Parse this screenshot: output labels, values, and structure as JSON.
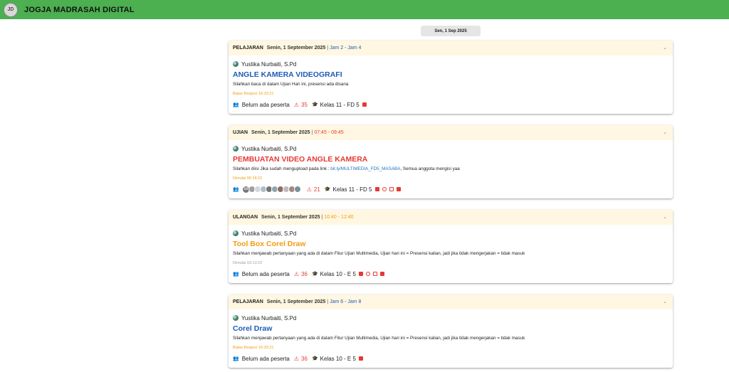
{
  "app": {
    "title": "JOGJA MADRASAH DIGITAL",
    "logo_text": "JD"
  },
  "date_pill": "Sen, 1 Sep 2025",
  "colors": {
    "topbar": "#4caf50",
    "header_bg": "#fff7e1",
    "blue": "#1e5bb8",
    "orange": "#f39c12",
    "red": "#e53935"
  },
  "cards": [
    {
      "type": "PELAJARAN",
      "date": "Senin, 1 September 2025",
      "separator": "|",
      "time": "Jam 2 - Jam 4",
      "time_color": "#1e5bb8",
      "teacher": "Yustika Nurbaiti, S.Pd",
      "subject": "ANGLE KAMERA VIDEOGRAFI",
      "subject_color": "#1e5bb8",
      "desc_pre": "Silahkan baca di dalam Ujian Hari ini, presensi ada disana",
      "desc_link": "",
      "desc_post": "",
      "meta": "Batas Respon 16:33:21",
      "meta_color": "#f39c12",
      "participants": "Belum ada peserta",
      "avatar_count": "",
      "absent": "35",
      "class": "Kelas 11 - FD 5",
      "icons": [
        "film-icon"
      ]
    },
    {
      "type": "UJIAN",
      "date": "Senin, 1 September 2025",
      "separator": "|",
      "time": "07:45 - 09:45",
      "time_color": "#e53935",
      "teacher": "Yustika Nurbaiti, S.Pd",
      "subject": "PEMBUATAN VIDEO ANGLE KAMERA",
      "subject_color": "#e53935",
      "desc_pre": "Silahkan diisi Jika sudah mengupload pada link : ",
      "desc_link": "bit.ly/MULTIMEDIA_FD5_MASABA",
      "desc_post": ", Semua anggota mengisi yaa",
      "meta": "Dimulai 00:18:22",
      "meta_color": "#f39c12",
      "participants": "",
      "avatar_count": "14",
      "absent": "21",
      "class": "Kelas 11 - FD 5",
      "icons": [
        "film-icon",
        "eye-off-icon",
        "report-icon",
        "alert-icon"
      ]
    },
    {
      "type": "ULANGAN",
      "date": "Senin, 1 September 2025",
      "separator": "|",
      "time": "10:40 - 12:40",
      "time_color": "#f39c12",
      "teacher": "Yustika Nurbaiti, S.Pd",
      "subject": "Tool Box Corel Draw",
      "subject_color": "#f39c12",
      "desc_pre": "Silahkan menjawab pertanyaan yang ada di dalam Fitur Ujian Multimedia, Ujian hari ini = Presensi kalian, jadi jika tidak mengerjakan = tidak masuk",
      "desc_link": "",
      "desc_post": "",
      "meta": "Dimulai 03:13:22",
      "meta_color": "#9e9e9e",
      "participants": "Belum ada peserta",
      "avatar_count": "",
      "absent": "36",
      "class": "Kelas 10 - E 5",
      "icons": [
        "film-icon",
        "eye-off-icon",
        "report-icon",
        "alert-icon"
      ]
    },
    {
      "type": "PELAJARAN",
      "date": "Senin, 1 September 2025",
      "separator": "|",
      "time": "Jam 6 - Jam 8",
      "time_color": "#1e5bb8",
      "teacher": "Yustika Nurbaiti, S.Pd",
      "subject": "Corel Draw",
      "subject_color": "#1e5bb8",
      "desc_pre": "Silahkan menjawab pertanyaan yang ada di dalam Fitur Ujian Multimedia, Ujian hari ini = Presensi kalian, jadi jika tidak mengerjakan = tidak masuk",
      "desc_link": "",
      "desc_post": "",
      "meta": "Batas Respon 16:33:21",
      "meta_color": "#f39c12",
      "participants": "Belum ada peserta",
      "avatar_count": "",
      "absent": "36",
      "class": "Kelas 10 - E 5",
      "icons": [
        "film-icon"
      ]
    }
  ]
}
